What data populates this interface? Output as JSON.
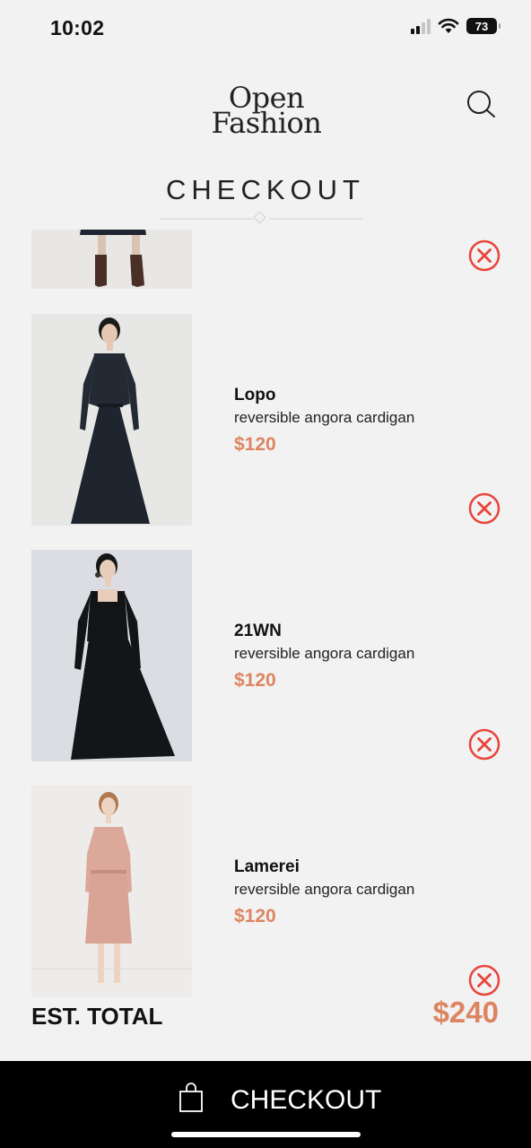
{
  "status": {
    "time": "10:02",
    "battery": "73"
  },
  "logo": {
    "line1": "Open",
    "line2": "Fashion"
  },
  "page_title": "CHECKOUT",
  "items": [
    {
      "brand": "",
      "desc": "",
      "price": ""
    },
    {
      "brand": "Lopo",
      "desc": "reversible angora cardigan",
      "price": "$120"
    },
    {
      "brand": "21WN",
      "desc": "reversible angora cardigan",
      "price": "$120"
    },
    {
      "brand": "Lamerei",
      "desc": "reversible angora cardigan",
      "price": "$120"
    }
  ],
  "total": {
    "label": "EST. TOTAL",
    "value": "$240"
  },
  "checkout_button": {
    "label": "CHECKOUT"
  },
  "colors": {
    "accent": "#dd8560",
    "remove": "#e8453c",
    "bar": "#000000",
    "background": "#f2f2f2"
  }
}
